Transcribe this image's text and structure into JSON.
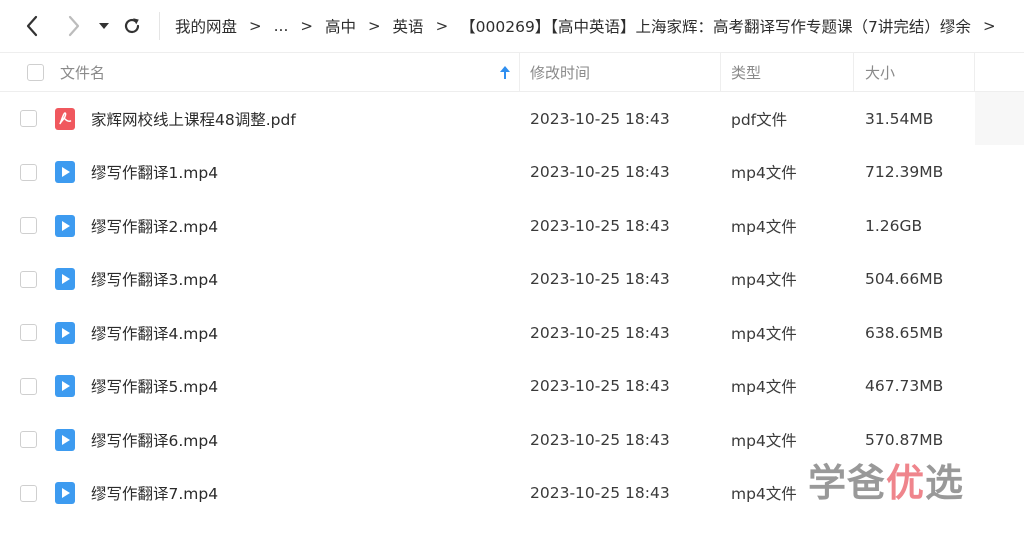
{
  "nav": {
    "back_icon": "chevron-left-icon",
    "forward_icon": "chevron-right-icon",
    "dropdown_icon": "caret-down-icon",
    "refresh_icon": "refresh-icon"
  },
  "breadcrumb": {
    "items": [
      "我的网盘",
      "...",
      "高中",
      "英语",
      "【000269】【高中英语】上海家辉：高考翻译写作专题课（7讲完结）缪余"
    ],
    "separator": ">",
    "overflow_separator": ">"
  },
  "table": {
    "columns": {
      "name": "文件名",
      "modified": "修改时间",
      "type": "类型",
      "size": "大小"
    },
    "sort_icon": "sort-up-arrow-icon",
    "rows": [
      {
        "name": "家辉网校线上课程48调整.pdf",
        "modified": "2023-10-25 18:43",
        "type": "pdf文件",
        "size": "31.54MB",
        "icon": "pdf-file-icon"
      },
      {
        "name": "缪写作翻译1.mp4",
        "modified": "2023-10-25 18:43",
        "type": "mp4文件",
        "size": "712.39MB",
        "icon": "video-file-icon"
      },
      {
        "name": "缪写作翻译2.mp4",
        "modified": "2023-10-25 18:43",
        "type": "mp4文件",
        "size": "1.26GB",
        "icon": "video-file-icon"
      },
      {
        "name": "缪写作翻译3.mp4",
        "modified": "2023-10-25 18:43",
        "type": "mp4文件",
        "size": "504.66MB",
        "icon": "video-file-icon"
      },
      {
        "name": "缪写作翻译4.mp4",
        "modified": "2023-10-25 18:43",
        "type": "mp4文件",
        "size": "638.65MB",
        "icon": "video-file-icon"
      },
      {
        "name": "缪写作翻译5.mp4",
        "modified": "2023-10-25 18:43",
        "type": "mp4文件",
        "size": "467.73MB",
        "icon": "video-file-icon"
      },
      {
        "name": "缪写作翻译6.mp4",
        "modified": "2023-10-25 18:43",
        "type": "mp4文件",
        "size": "570.87MB",
        "icon": "video-file-icon"
      },
      {
        "name": "缪写作翻译7.mp4",
        "modified": "2023-10-25 18:43",
        "type": "mp4文件",
        "size": "",
        "icon": "video-file-icon"
      }
    ]
  },
  "watermark": {
    "part1": "学爸",
    "part2": "优",
    "part3": "选"
  },
  "colors": {
    "pdf_icon": "#f0585e",
    "video_icon": "#3d9bf0",
    "sort_arrow": "#2f8ff0"
  }
}
